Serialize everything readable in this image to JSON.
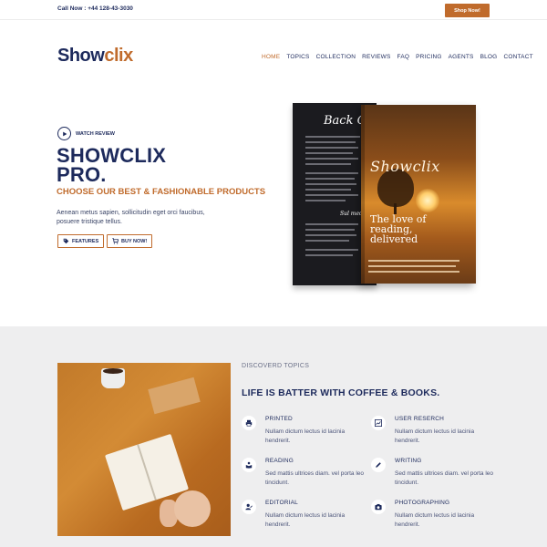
{
  "topbar": {
    "call": "Call Now : +44 128-43-3030",
    "shop_now": "Shop Now!"
  },
  "logo": {
    "part1": "Show",
    "part2": "clix"
  },
  "nav": [
    "HOME",
    "TOPICS",
    "COLLECTION",
    "REVIEWS",
    "FAQ",
    "PRICING",
    "AGENTS",
    "BLOG",
    "CONTACT"
  ],
  "hero": {
    "watch_review": "WATCH REVIEW",
    "title_line1": "SHOWCLIX",
    "title_line2": "PRO.",
    "subtitle": "CHOOSE OUR BEST & FASHIONABLE PRODUCTS",
    "description": "Aenean metus sapien, sollicitudin eget orci faucibus, posuere tristique tellus.",
    "features_btn": "FEATURES",
    "buy_btn": "BUY NOW!"
  },
  "book": {
    "back_title": "Back C",
    "front_title": "Showclix",
    "tagline": "The love of reading, delivered",
    "signature": "Sul med"
  },
  "section2": {
    "eyebrow": "DISCOVERD TOPICS",
    "title": "LIFE IS BATTER WITH COFFEE & BOOKS.",
    "features": [
      {
        "title": "PRINTED",
        "desc": "Nullam dictum lectus id lacinia hendrerit.",
        "icon": "print-icon"
      },
      {
        "title": "USER RESERCH",
        "desc": "Nullam dictum lectus id lacinia hendrerit.",
        "icon": "chart-icon"
      },
      {
        "title": "READING",
        "desc": "Sed mattis ultrices diam. vel porta leo tincidunt.",
        "icon": "reading-icon"
      },
      {
        "title": "WRITING",
        "desc": "Sed mattis ultrices diam. vel porta leo tincidunt.",
        "icon": "pen-icon"
      },
      {
        "title": "EDITORIAL",
        "desc": "Nullam dictum lectus id lacinia hendrerit.",
        "icon": "user-edit-icon"
      },
      {
        "title": "PHOTOGRAPHING",
        "desc": "Nullam dictum lectus id lacinia hendrerit.",
        "icon": "camera-icon"
      }
    ]
  },
  "colors": {
    "navy": "#1d2a5c",
    "accent": "#c06b2c",
    "section_bg": "#eeeeef"
  }
}
